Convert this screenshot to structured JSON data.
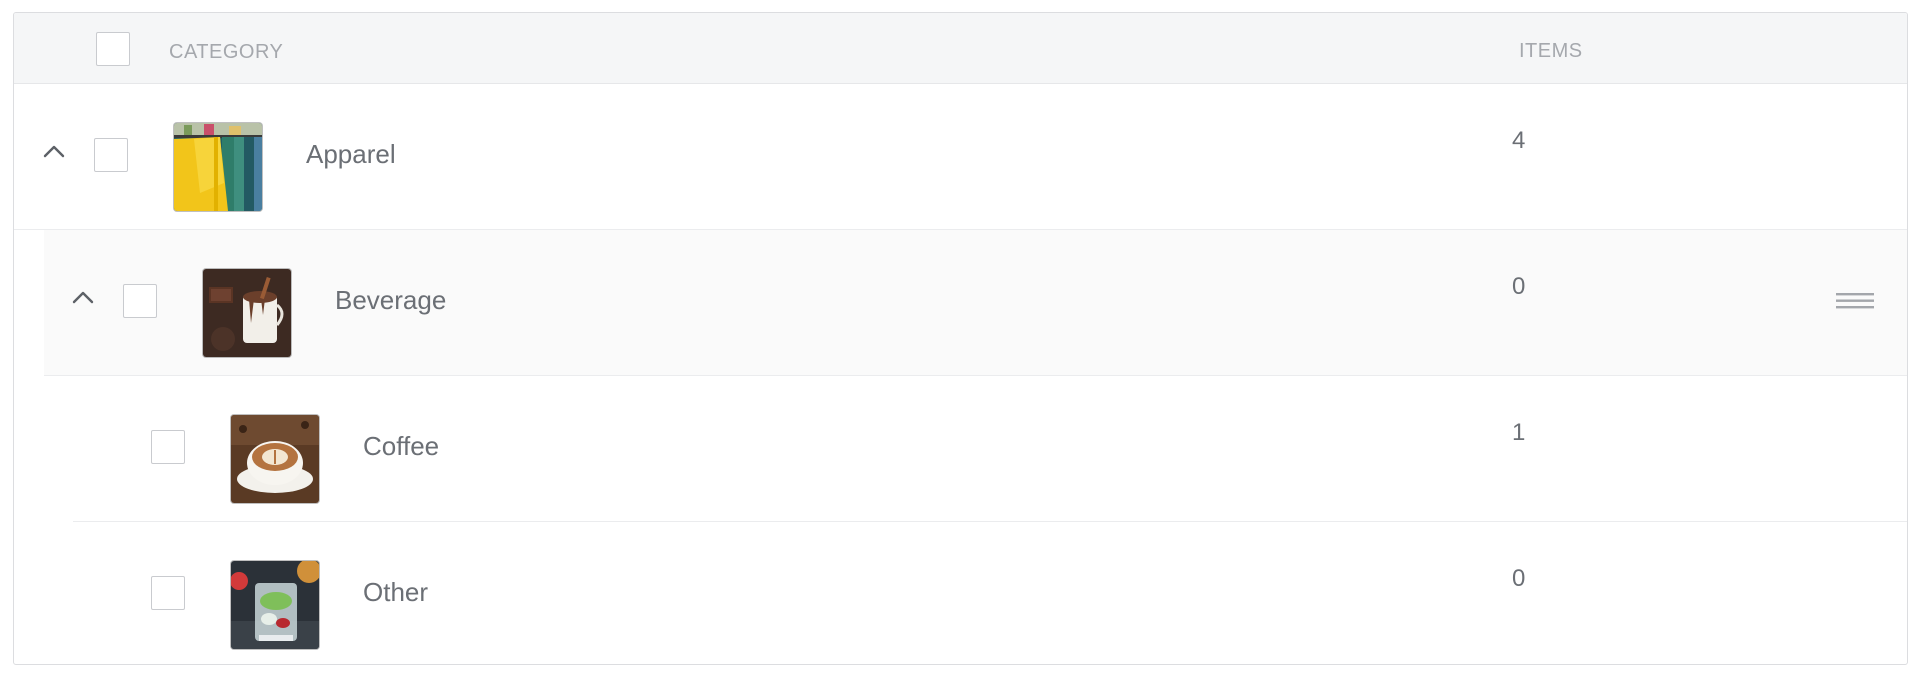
{
  "header": {
    "category_label": "CATEGORY",
    "items_label": "ITEMS"
  },
  "rows": [
    {
      "name": "Apparel",
      "items": "4",
      "expanded": true,
      "level": 0,
      "image": "clothing-rack-image"
    },
    {
      "name": "Beverage",
      "items": "0",
      "expanded": true,
      "level": 1,
      "image": "hot-chocolate-image"
    },
    {
      "name": "Coffee",
      "items": "1",
      "level": 2,
      "image": "latte-cup-image"
    },
    {
      "name": "Other",
      "items": "0",
      "level": 2,
      "image": "iced-drink-image"
    }
  ],
  "icons": {
    "expand": "chevron-up-icon",
    "reorder": "drag-handle-icon"
  },
  "colors": {
    "header_bg": "#f5f6f7",
    "text": "#6b6f75",
    "header_text": "#a5a8ad",
    "border": "#dcdde0"
  }
}
